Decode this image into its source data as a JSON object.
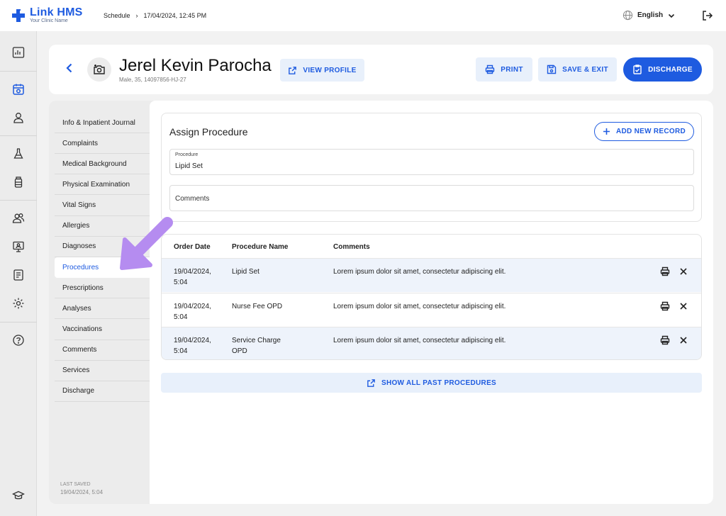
{
  "brand": {
    "name": "Link HMS",
    "tagline": "Your Clinic Name",
    "color": "#1e5be0"
  },
  "breadcrumb": {
    "section": "Schedule",
    "separator": "›",
    "datetime": "17/04/2024, 12:45 PM"
  },
  "language": {
    "selected": "English"
  },
  "rail": {
    "icons": [
      "dashboard-icon",
      "calendar-icon",
      "user-icon",
      "flask-icon",
      "medicine-bottle-icon",
      "users-icon",
      "monitor-icon",
      "report-icon",
      "gear-icon",
      "help-icon",
      "graduation-cap-icon"
    ],
    "active": "calendar-icon"
  },
  "patient": {
    "name": "Jerel Kevin Parocha",
    "info": "Male, 35, 14097856-HJ-27"
  },
  "header_buttons": {
    "view_profile": "VIEW PROFILE",
    "print": "PRINT",
    "save_exit": "SAVE & EXIT",
    "discharge": "DISCHARGE"
  },
  "nav": {
    "items": [
      "Info & Inpatient Journal",
      "Complaints",
      "Medical Background",
      "Physical Examination",
      "Vital Signs",
      "Allergies",
      "Diagnoses",
      "Procedures",
      "Prescriptions",
      "Analyses",
      "Vaccinations",
      "Comments",
      "Services",
      "Discharge"
    ],
    "active_index": 7,
    "last_saved_label": "LAST SAVED",
    "last_saved_value": "19/04/2024, 5:04"
  },
  "assign": {
    "title": "Assign Procedure",
    "add_button": "ADD NEW RECORD",
    "procedure_label": "Procedure",
    "procedure_value": "Lipid Set",
    "comments_placeholder": "Comments"
  },
  "table": {
    "columns": [
      "Order Date",
      "Procedure Name",
      "Comments"
    ],
    "rows": [
      {
        "date_line1": "19/04/2024,",
        "date_line2": "5:04",
        "name_line1": "Lipid Set",
        "name_line2": "",
        "comment": "Lorem ipsum dolor sit amet, consectetur adipiscing elit."
      },
      {
        "date_line1": "19/04/2024,",
        "date_line2": "5:04",
        "name_line1": "Nurse Fee OPD",
        "name_line2": "",
        "comment": "Lorem ipsum dolor sit amet, consectetur adipiscing elit."
      },
      {
        "date_line1": "19/04/2024,",
        "date_line2": "5:04",
        "name_line1": "Service Charge",
        "name_line2": "OPD",
        "comment": "Lorem ipsum dolor sit amet, consectetur adipiscing elit."
      }
    ]
  },
  "show_all": "SHOW ALL PAST PROCEDURES",
  "annotation_arrow_color": "#b58cf0"
}
